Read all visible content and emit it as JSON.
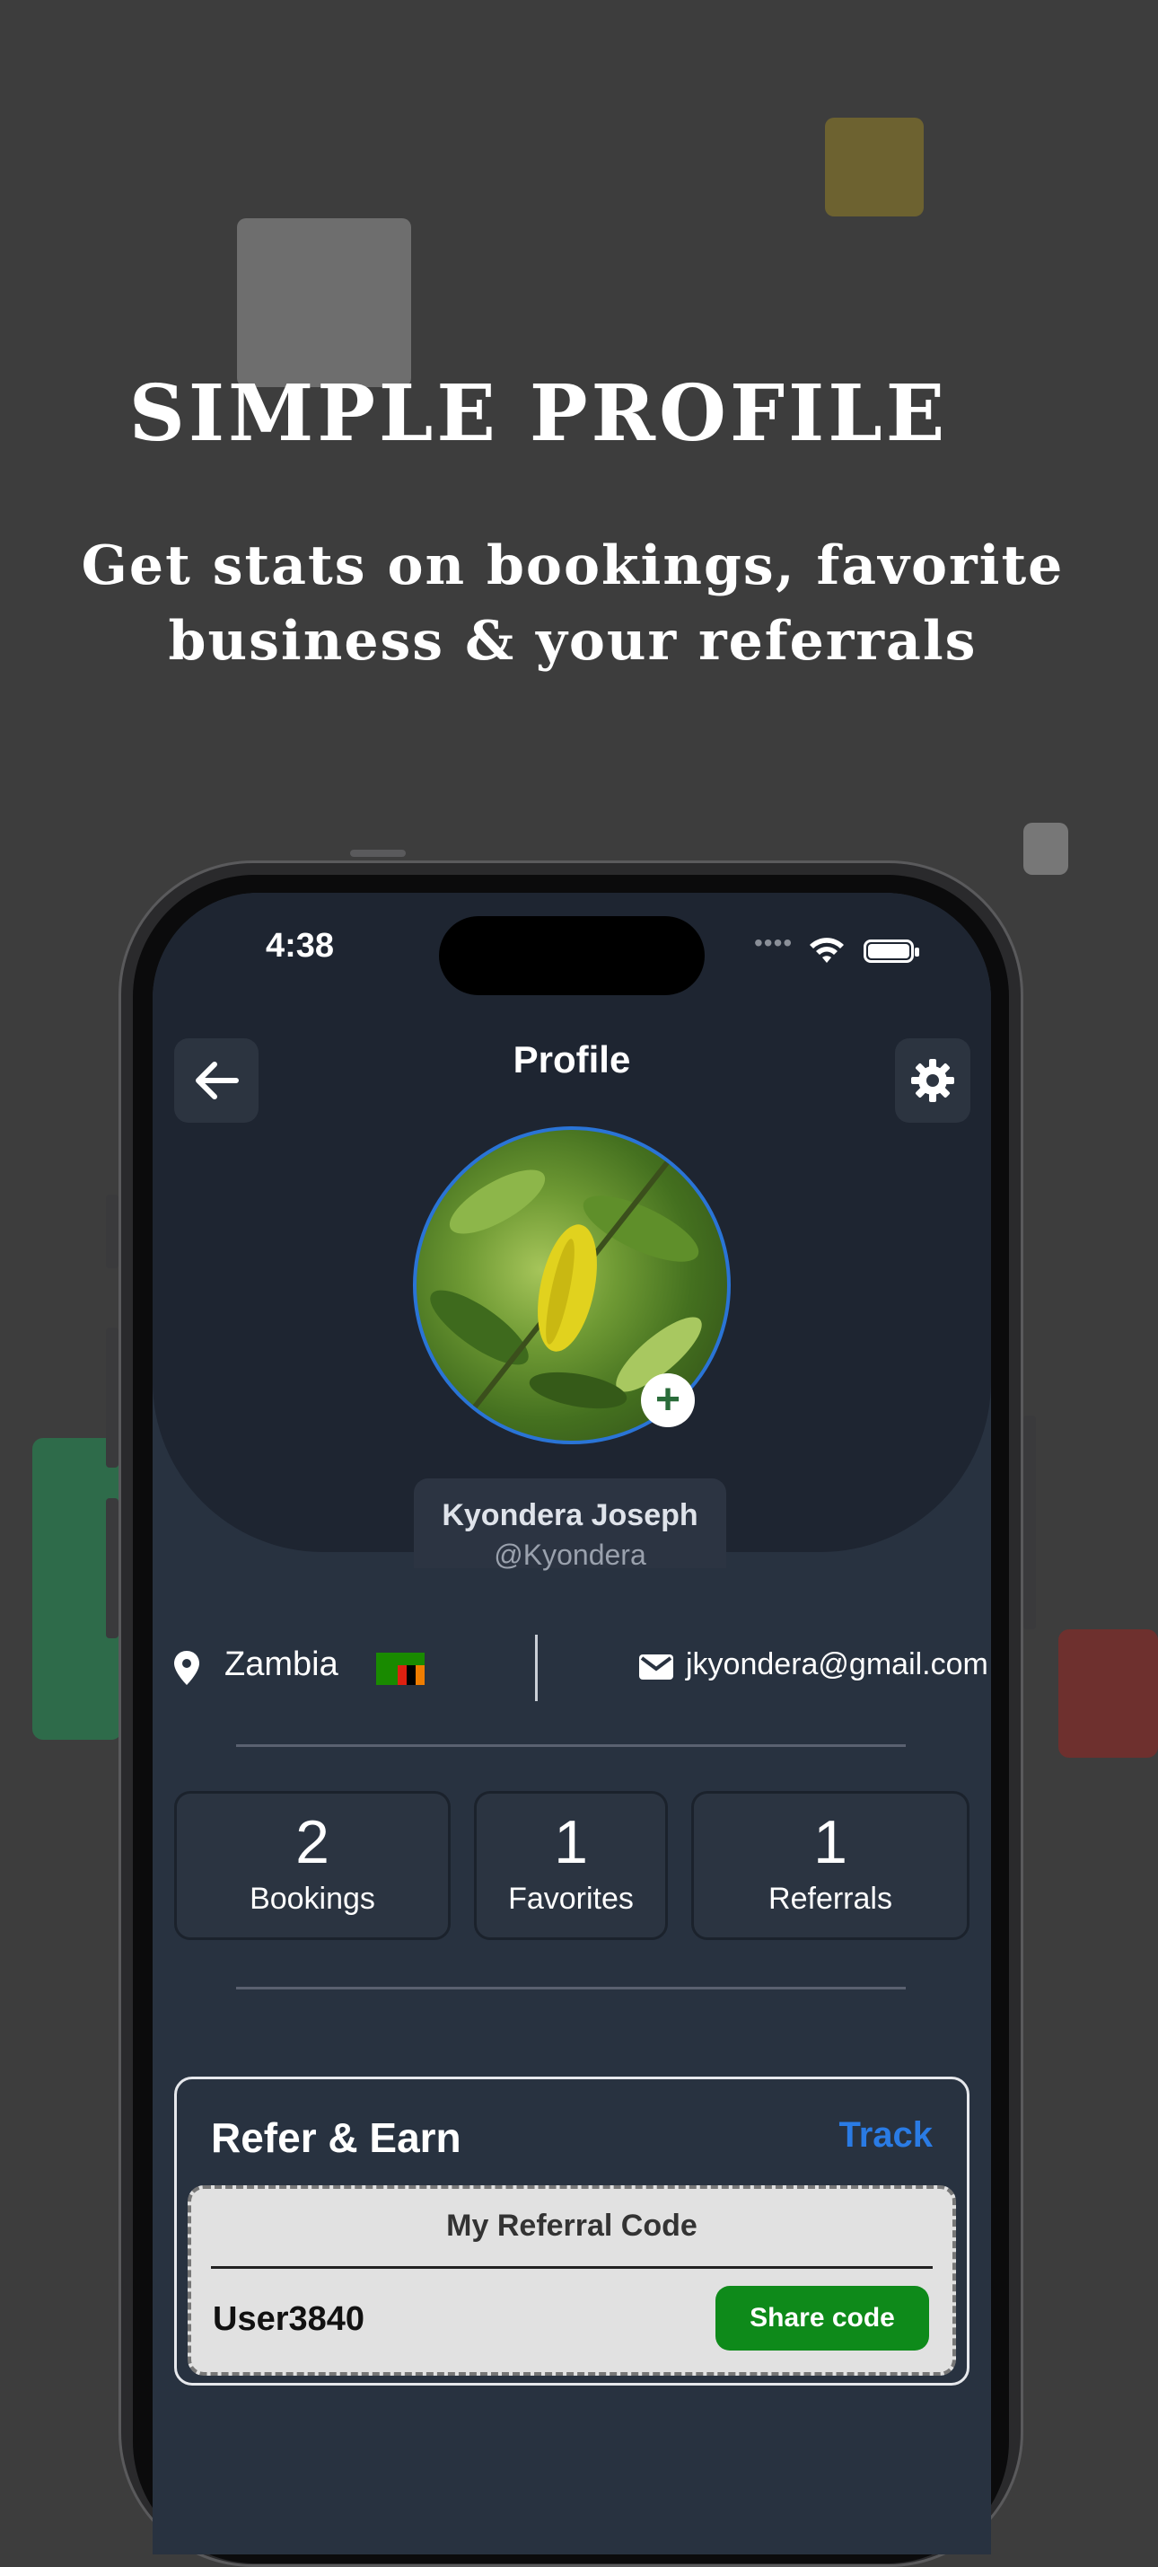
{
  "headline": {
    "title": "SIMPLE PROFILE",
    "subtitle_line1": "Get stats on bookings, favorite",
    "subtitle_line2": "business & your referrals"
  },
  "status_bar": {
    "time": "4:38"
  },
  "header": {
    "title": "Profile",
    "back_icon": "arrow-left-icon",
    "settings_icon": "gear-icon"
  },
  "profile": {
    "name": "Kyondera Joseph",
    "handle": "@Kyondera",
    "add_photo_symbol": "+"
  },
  "contact": {
    "country": "Zambia",
    "email": "jkyondera@gmail.com"
  },
  "stats": [
    {
      "value": "2",
      "label": "Bookings"
    },
    {
      "value": "1",
      "label": "Favorites"
    },
    {
      "value": "1",
      "label": "Referrals"
    }
  ],
  "refer": {
    "title": "Refer & Earn",
    "track_label": "Track",
    "code_title": "My Referral Code",
    "code": "User3840",
    "share_label": "Share code"
  },
  "colors": {
    "accent_blue": "#2a7be4",
    "share_green": "#0e8a1a",
    "screen_bg": "#283240",
    "header_bg": "#1e2531"
  }
}
